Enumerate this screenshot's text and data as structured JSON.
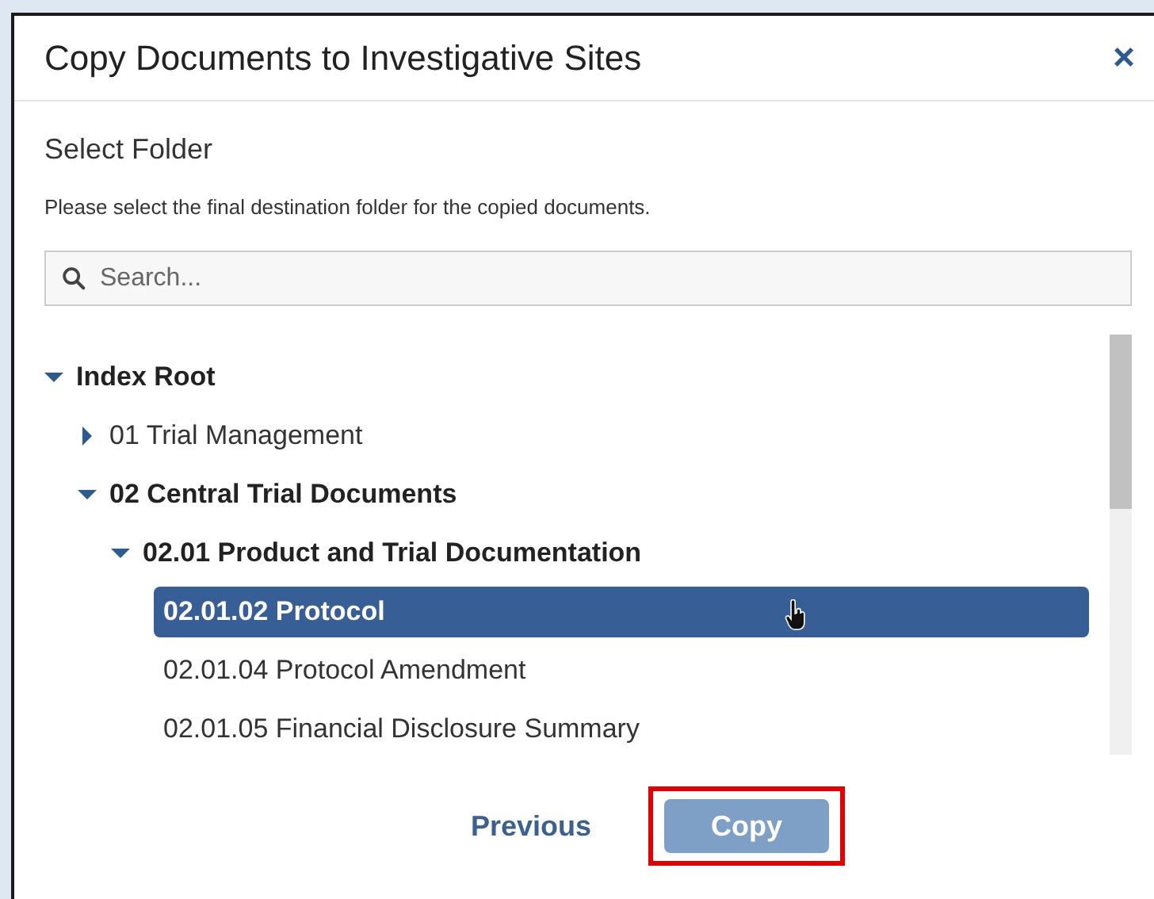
{
  "dialog": {
    "title": "Copy Documents to Investigative Sites",
    "close": "×"
  },
  "section_title": "Select Folder",
  "description": "Please select the final destination folder for the copied documents.",
  "search": {
    "placeholder": "Search..."
  },
  "tree": [
    {
      "label": "Index Root",
      "kind": "folder",
      "expanded": true,
      "selected": false,
      "children": [
        {
          "label": "01 Trial Management",
          "kind": "folder",
          "expanded": false,
          "selected": false
        },
        {
          "label": "02 Central Trial Documents",
          "kind": "folder",
          "expanded": true,
          "selected": false,
          "children": [
            {
              "label": "02.01 Product and Trial Documentation",
              "kind": "folder",
              "expanded": true,
              "selected": false,
              "children": [
                {
                  "label": "02.01.02 Protocol",
                  "kind": "leaf",
                  "selected": true
                },
                {
                  "label": "02.01.04 Protocol Amendment",
                  "kind": "leaf",
                  "selected": false
                },
                {
                  "label": "02.01.05 Financial Disclosure Summary",
                  "kind": "leaf",
                  "selected": false
                }
              ]
            }
          ]
        }
      ]
    }
  ],
  "buttons": [
    {
      "label": "Previous",
      "kind": "link",
      "disabled": false,
      "highlighted": false
    },
    {
      "label": "Copy",
      "kind": "primary",
      "disabled": true,
      "highlighted": true
    }
  ]
}
